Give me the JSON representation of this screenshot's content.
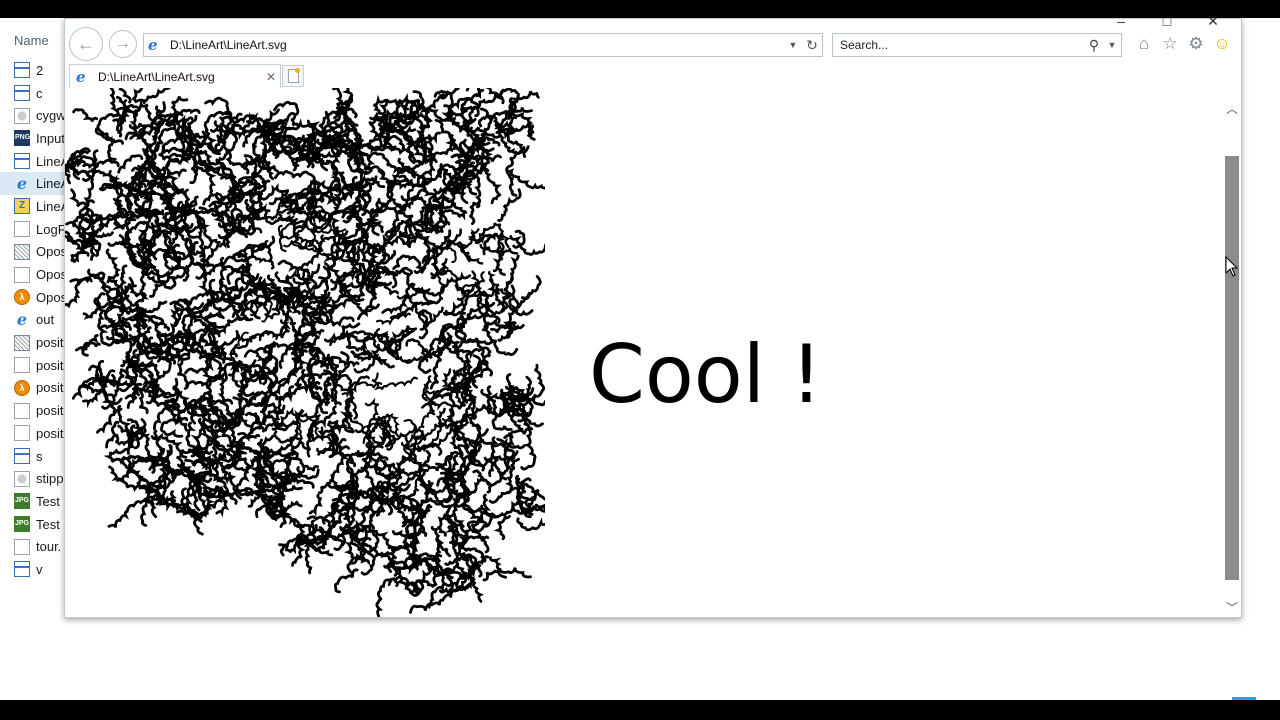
{
  "explorer": {
    "column_header": "Name",
    "files": [
      {
        "name": "2",
        "icon": "exe-icon"
      },
      {
        "name": "c",
        "icon": "exe-icon"
      },
      {
        "name": "cygw",
        "icon": "cygwin-file-icon"
      },
      {
        "name": "Input",
        "icon": "png-icon"
      },
      {
        "name": "LineA",
        "icon": "exe-icon"
      },
      {
        "name": "LineA",
        "icon": "ie-icon",
        "selected": true
      },
      {
        "name": "LineA",
        "icon": "zip-icon"
      },
      {
        "name": "LogF",
        "icon": "text-file-icon"
      },
      {
        "name": "Opos",
        "icon": "gif-icon"
      },
      {
        "name": "Opos",
        "icon": "text-file-icon"
      },
      {
        "name": "Opos",
        "icon": "halflife-icon"
      },
      {
        "name": "out",
        "icon": "ie-icon"
      },
      {
        "name": "posit",
        "icon": "gif-icon"
      },
      {
        "name": "posit",
        "icon": "text-file-icon"
      },
      {
        "name": "posit",
        "icon": "halflife-icon"
      },
      {
        "name": "posit",
        "icon": "text-file-icon"
      },
      {
        "name": "posit",
        "icon": "text-file-icon"
      },
      {
        "name": "s",
        "icon": "exe-icon"
      },
      {
        "name": "stipp",
        "icon": "cygwin-file-icon"
      },
      {
        "name": "Test",
        "icon": "jpg-icon"
      },
      {
        "name": "Test",
        "icon": "jpg-icon"
      },
      {
        "name": "tour.",
        "icon": "text-file-icon"
      },
      {
        "name": "v",
        "icon": "exe-icon"
      }
    ]
  },
  "browser": {
    "address": "D:\\LineArt\\LineArt.svg",
    "search_placeholder": "Search...",
    "tab_title": "D:\\LineArt\\LineArt.svg",
    "page_text": "Cool !",
    "scroll_position": 0.12
  },
  "icon_labels": {
    "png": "PNG",
    "jpg": "JPG",
    "zip": "Z",
    "halflife": "λ",
    "ie": "e"
  }
}
